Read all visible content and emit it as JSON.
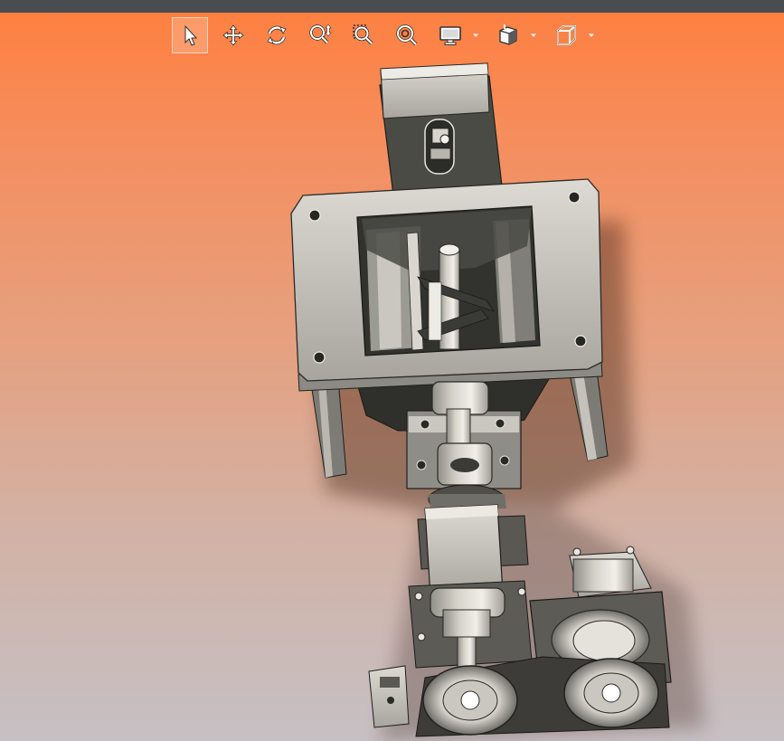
{
  "window": {
    "title": ""
  },
  "toolbar": {
    "tools": [
      {
        "name": "select-tool",
        "icon": "arrow-cursor-icon",
        "active": true
      },
      {
        "name": "pan-tool",
        "icon": "pan-arrows-icon",
        "active": false
      },
      {
        "name": "rotate-tool",
        "icon": "rotate-icon",
        "active": false
      },
      {
        "name": "zoom-tool",
        "icon": "zoom-updown-icon",
        "active": false
      },
      {
        "name": "zoom-area-tool",
        "icon": "zoom-area-icon",
        "active": false
      },
      {
        "name": "zoom-fit-tool",
        "icon": "zoom-fit-icon",
        "active": false
      }
    ],
    "dropdowns": [
      {
        "name": "display-style-dropdown",
        "icon": "monitor-icon"
      },
      {
        "name": "section-view-dropdown",
        "icon": "section-cube-icon"
      },
      {
        "name": "view-orientation-dropdown",
        "icon": "wire-cube-icon"
      }
    ]
  },
  "viewport": {
    "background_top": "#ff7f3f",
    "background_bottom": "#c6c0c4",
    "model_name": "mechanical-assembly"
  }
}
